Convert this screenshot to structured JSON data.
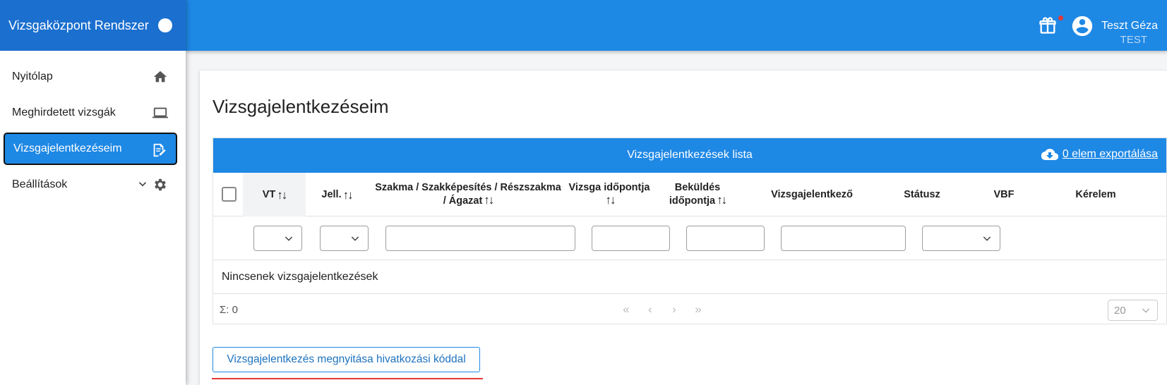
{
  "app": {
    "title": "Vizsgaközpont Rendszer"
  },
  "sidebar": {
    "items": [
      {
        "label": "Nyitólap",
        "icon": "home-icon"
      },
      {
        "label": "Meghirdetett vizsgák",
        "icon": "laptop-icon"
      },
      {
        "label": "Vizsgajelentkezéseim",
        "icon": "edit-document-icon",
        "active": true
      },
      {
        "label": "Beállítások",
        "icon": "gear-icon"
      }
    ]
  },
  "user": {
    "name": "Teszt Géza",
    "role": "TEST"
  },
  "page": {
    "title": "Vizsgajelentkezéseim"
  },
  "table": {
    "title": "Vizsgajelentkezések lista",
    "export_label": "0 elem exportálása",
    "columns": [
      "VT",
      "Jell.",
      "Szakma / Szakképesítés / Részszakma / Ágazat",
      "Vizsga időpontja",
      "Beküldés időpontja",
      "Vizsgajelentkező",
      "Státusz",
      "VBF",
      "Kérelem"
    ],
    "sort_glyph": "↑↓",
    "empty_text": "Nincsenek vizsgajelentkezések",
    "sum_label": "Σ: 0",
    "pager": [
      "«",
      "‹",
      "›",
      "»"
    ],
    "page_size": "20"
  },
  "actions": {
    "open_by_code": "Vizsgajelentkezés megnyitása hivatkozási kóddal"
  },
  "colors": {
    "primary": "#1e88e5",
    "brand": "#1a6fcf",
    "highlight": "#e53935"
  }
}
